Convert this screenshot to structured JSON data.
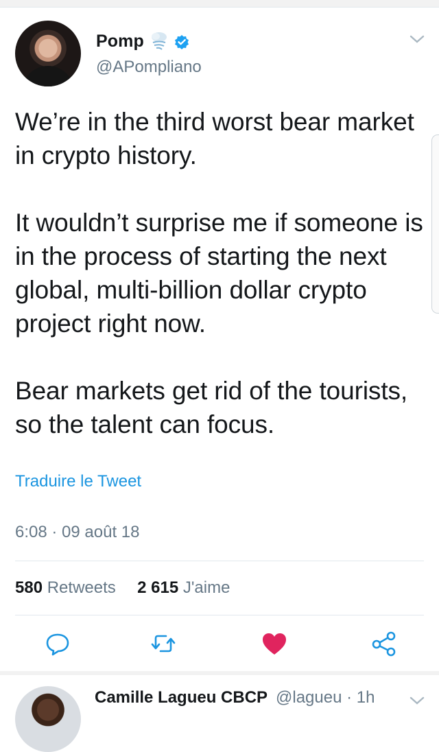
{
  "tweet": {
    "author_name": "Pomp",
    "author_handle": "@APompliano",
    "icons": {
      "emoji": "cloud-with-wind-icon",
      "verified": "verified-badge-icon",
      "menu": "chevron-down-icon"
    },
    "paragraphs": [
      "We’re in the third worst bear market in crypto history.",
      "It wouldn’t surprise me if someone is in the process of starting the next global, multi-billion dollar crypto project right now.",
      "Bear markets get rid of the tourists, so the talent can focus."
    ],
    "translate_label": "Traduire le Tweet",
    "timestamp": "6:08 · 09 août 18",
    "retweets_count": "580",
    "retweets_label": "Retweets",
    "likes_count": "2 615",
    "likes_label": "J'aime",
    "actions": [
      "reply-icon",
      "retweet-icon",
      "like-heart-icon",
      "share-icon"
    ]
  },
  "reply": {
    "author_name": "Camille Lagueu CBCP",
    "author_handle_time": "@lagueu · 1h"
  },
  "colors": {
    "accent": "#1b95e0",
    "like": "#e0245e",
    "muted": "#657786",
    "text": "#14171a"
  }
}
